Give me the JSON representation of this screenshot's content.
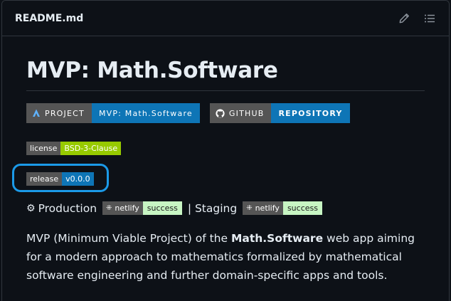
{
  "header": {
    "filename": "README.md",
    "edit_icon": "pencil-icon",
    "outline_icon": "list-icon"
  },
  "title": "MVP: Math.Software",
  "big_badges": [
    {
      "label": "PROJECT",
      "value": "MVP: Math.Software",
      "icon": "project-logo-icon",
      "color": "#0e75b6"
    },
    {
      "label": "GITHUB",
      "value": "REPOSITORY",
      "icon": "github-icon",
      "color": "#0e75b6"
    }
  ],
  "license_badge": {
    "label": "license",
    "value": "BSD-3-Clause",
    "color": "#97ca00"
  },
  "release_badge": {
    "label": "release",
    "value": "v0.0.0",
    "color": "#0e75b6"
  },
  "environments": {
    "production_label": "Production",
    "separator": "| Staging",
    "production_badge": {
      "label": "netlify",
      "value": "success"
    },
    "staging_badge": {
      "label": "netlify",
      "value": "success"
    }
  },
  "description": {
    "pre": "MVP (Minimum Viable Project) of the ",
    "bold": "Math.Software",
    "post": " web app aiming for a modern approach to mathematics formalized by mathematical software engineering and further domain-specific apps and tools."
  },
  "colors": {
    "background": "#0d1117",
    "border": "#30363d",
    "highlight": "#1b9ae8"
  }
}
